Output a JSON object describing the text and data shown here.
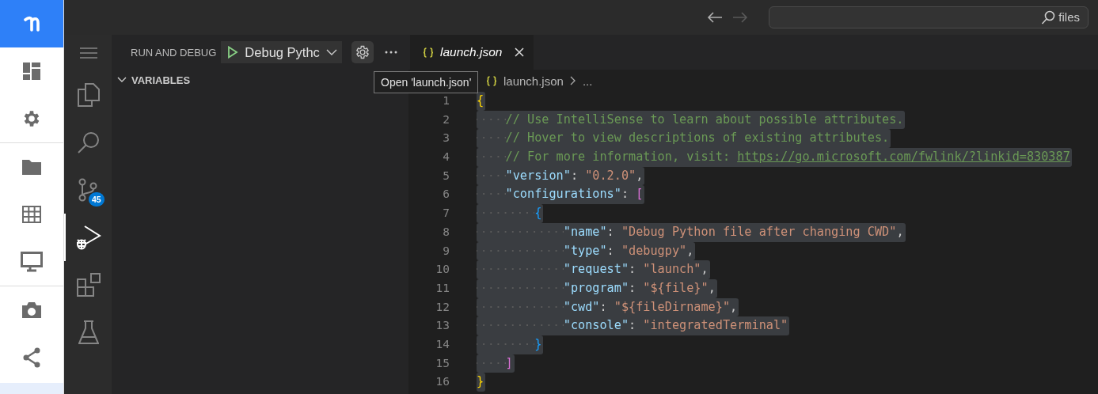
{
  "rail": {
    "items": [
      {
        "kind": "logo"
      },
      {
        "kind": "dashboard"
      },
      {
        "kind": "settings"
      },
      {
        "kind": "divider"
      },
      {
        "kind": "folder"
      },
      {
        "kind": "grid"
      },
      {
        "kind": "monitor"
      },
      {
        "kind": "divider"
      },
      {
        "kind": "camera"
      },
      {
        "kind": "share"
      },
      {
        "kind": "highlight"
      }
    ]
  },
  "title_bar": {
    "back_disabled": false,
    "forward_disabled": true,
    "search_label": "files"
  },
  "activity_bar": {
    "items": [
      {
        "kind": "menu",
        "selected": false
      },
      {
        "kind": "files",
        "selected": false
      },
      {
        "kind": "search",
        "selected": false
      },
      {
        "kind": "source-control",
        "selected": false,
        "badge": "45"
      },
      {
        "kind": "run-debug",
        "selected": true
      },
      {
        "kind": "extensions",
        "selected": false
      },
      {
        "kind": "testing",
        "selected": false
      }
    ]
  },
  "run_panel": {
    "title": "RUN AND DEBUG",
    "configuration": "Debug Pythc",
    "section": {
      "title": "VARIABLES",
      "expanded": true
    }
  },
  "tooltip": "Open 'launch.json'",
  "editor": {
    "tabs": [
      {
        "label": "launch.json",
        "selected": true
      }
    ],
    "breadcrumb": [
      "launch.json",
      "..."
    ],
    "lines": [
      {
        "number": "1",
        "selected": true,
        "tokens": [
          {
            "kind": "bracket1",
            "text": "{"
          }
        ]
      },
      {
        "number": "2",
        "selected": true,
        "tokens": [
          {
            "kind": "comment",
            "text": "    // Use IntelliSense to learn about possible attributes."
          }
        ]
      },
      {
        "number": "3",
        "selected": true,
        "tokens": [
          {
            "kind": "comment",
            "text": "    // Hover to view descriptions of existing attributes."
          }
        ]
      },
      {
        "number": "4",
        "selected": true,
        "tokens": [
          {
            "kind": "comment",
            "text": "    // For more information, visit: "
          },
          {
            "kind": "link",
            "text": "https://go.microsoft.com/fwlink/?linkid=830387"
          }
        ]
      },
      {
        "number": "5",
        "selected": true,
        "tokens": [
          {
            "kind": "key",
            "text": "    \"version\""
          },
          {
            "kind": "punct",
            "text": ": "
          },
          {
            "kind": "string",
            "text": "\"0.2.0\""
          },
          {
            "kind": "punct",
            "text": ","
          }
        ]
      },
      {
        "number": "6",
        "selected": true,
        "tokens": [
          {
            "kind": "key",
            "text": "    \"configurations\""
          },
          {
            "kind": "punct",
            "text": ": "
          },
          {
            "kind": "bracket2",
            "text": "["
          }
        ]
      },
      {
        "number": "7",
        "selected": true,
        "tokens": [
          {
            "kind": "bracket3",
            "text": "        {"
          }
        ]
      },
      {
        "number": "8",
        "selected": true,
        "tokens": [
          {
            "kind": "key",
            "text": "            \"name\""
          },
          {
            "kind": "punct",
            "text": ": "
          },
          {
            "kind": "string",
            "text": "\"Debug Python file after changing CWD\""
          },
          {
            "kind": "punct",
            "text": ","
          }
        ]
      },
      {
        "number": "9",
        "selected": true,
        "tokens": [
          {
            "kind": "key",
            "text": "            \"type\""
          },
          {
            "kind": "punct",
            "text": ": "
          },
          {
            "kind": "string",
            "text": "\"debugpy\""
          },
          {
            "kind": "punct",
            "text": ","
          }
        ]
      },
      {
        "number": "10",
        "selected": true,
        "tokens": [
          {
            "kind": "key",
            "text": "            \"request\""
          },
          {
            "kind": "punct",
            "text": ": "
          },
          {
            "kind": "string",
            "text": "\"launch\""
          },
          {
            "kind": "punct",
            "text": ","
          }
        ]
      },
      {
        "number": "11",
        "selected": true,
        "tokens": [
          {
            "kind": "key",
            "text": "            \"program\""
          },
          {
            "kind": "punct",
            "text": ": "
          },
          {
            "kind": "string",
            "text": "\"${file}\""
          },
          {
            "kind": "punct",
            "text": ","
          }
        ]
      },
      {
        "number": "12",
        "selected": true,
        "tokens": [
          {
            "kind": "key",
            "text": "            \"cwd\""
          },
          {
            "kind": "punct",
            "text": ": "
          },
          {
            "kind": "string",
            "text": "\"${fileDirname}\""
          },
          {
            "kind": "punct",
            "text": ","
          }
        ]
      },
      {
        "number": "13",
        "selected": true,
        "tokens": [
          {
            "kind": "key",
            "text": "            \"console\""
          },
          {
            "kind": "punct",
            "text": ": "
          },
          {
            "kind": "string",
            "text": "\"integratedTerminal\""
          }
        ]
      },
      {
        "number": "14",
        "selected": true,
        "tokens": [
          {
            "kind": "bracket3",
            "text": "        }"
          }
        ]
      },
      {
        "number": "15",
        "selected": true,
        "tokens": [
          {
            "kind": "bracket2",
            "text": "    ]"
          }
        ]
      },
      {
        "number": "16",
        "selected": true,
        "tokens": [
          {
            "kind": "bracket1",
            "text": "}"
          }
        ]
      }
    ]
  }
}
